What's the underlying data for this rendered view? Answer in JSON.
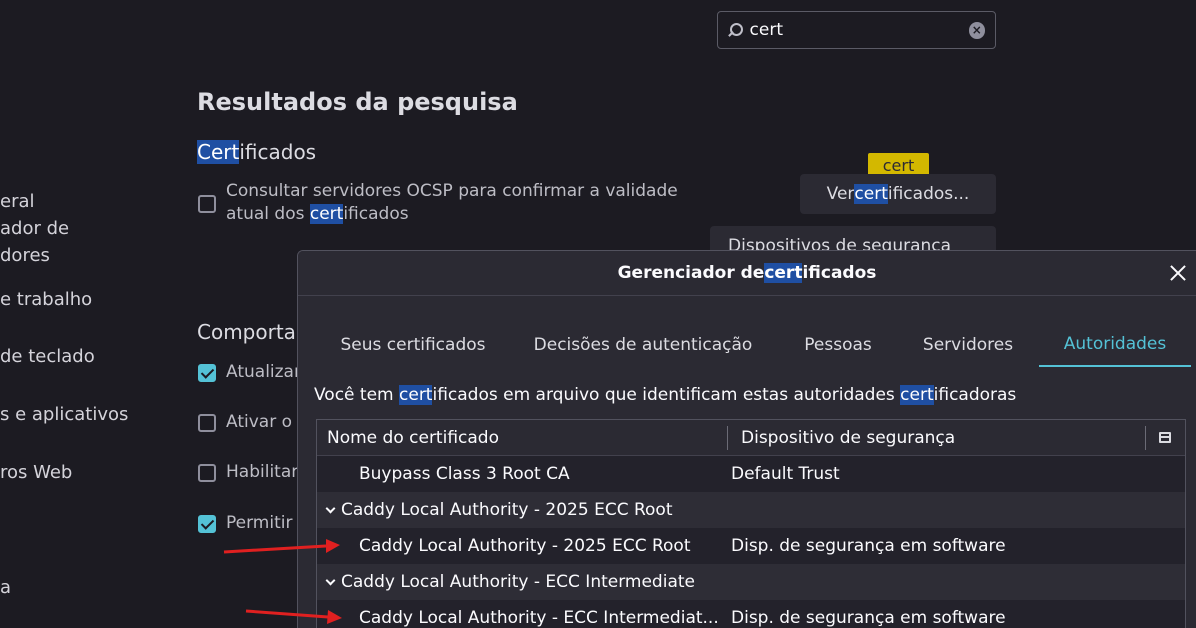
{
  "search": {
    "value": "cert"
  },
  "sidebar": {
    "items": [
      {
        "label": "eral"
      },
      {
        "label": "ador de"
      },
      {
        "label": "dores"
      },
      {
        "label": "e trabalho"
      },
      {
        "label": "de teclado"
      },
      {
        "label": "s e aplicativos"
      },
      {
        "label": "ros Web"
      },
      {
        "label": "a"
      }
    ]
  },
  "main": {
    "heading": "Resultados da pesquisa",
    "section": {
      "pre": "Cert",
      "post": "ificados"
    },
    "ocsp": {
      "line1": "Consultar servidores OCSP para confirmar a validade",
      "line2_pre": "atual dos ",
      "line2_hl": "cert",
      "line2_post": "ificados"
    },
    "tooltip": "cert",
    "view_button": {
      "pre": "Ver ",
      "hl": "cert",
      "post": "ificados..."
    },
    "devices_button": "Dispositivos de segurança",
    "behavior_heading": "Comporta",
    "options": [
      {
        "label": "Atualizar",
        "checked": true
      },
      {
        "label": "Ativar o",
        "checked": false
      },
      {
        "label": "Habilitar",
        "checked": false
      },
      {
        "label": "Permitir",
        "checked": true
      }
    ]
  },
  "dialog": {
    "title": {
      "pre": "Gerenciador de ",
      "hl": "cert",
      "post": "ificados"
    },
    "tabs": [
      {
        "label": "Seus certificados"
      },
      {
        "label": "Decisões de autenticação"
      },
      {
        "label": "Pessoas"
      },
      {
        "label": "Servidores"
      },
      {
        "label": "Autoridades"
      }
    ],
    "intro": {
      "a": "Você tem ",
      "b": "cert",
      "c": "ificados em arquivo que identificam estas autoridades ",
      "d": "cert",
      "e": "ificadoras"
    },
    "columns": {
      "name": "Nome do certificado",
      "device": "Dispositivo de segurança"
    },
    "rows": [
      {
        "name": "Buypass Class 3 Root CA",
        "device": "Default Trust"
      },
      {
        "name": "Caddy Local Authority - 2025 ECC Root",
        "device": ""
      },
      {
        "name": "Caddy Local Authority - 2025 ECC Root",
        "device": "Disp. de segurança em software"
      },
      {
        "name": "Caddy Local Authority - ECC Intermediate",
        "device": ""
      },
      {
        "name": "Caddy Local Authority - ECC Intermediat...",
        "device": "Disp. de segurança em software"
      }
    ]
  },
  "colors": {
    "accent": "#54c2d6",
    "highlight": "#1f4fa3",
    "tooltip": "#d3b800",
    "arrow": "#e02020"
  }
}
